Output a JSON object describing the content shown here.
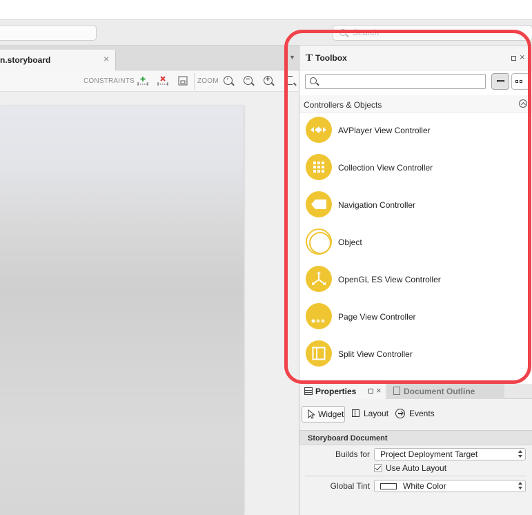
{
  "toolbar": {
    "search_placeholder": "Search"
  },
  "document": {
    "tab_label": "n.storyboard",
    "close_glyph": "×",
    "overflow_glyph": "▼"
  },
  "designer": {
    "constraints_label": "CONSTRAINTS",
    "zoom_label": "ZOOM"
  },
  "toolbox": {
    "title": "Toolbox",
    "search_placeholder": "",
    "section": "Controllers & Objects",
    "items": [
      {
        "label": "AVPlayer View Controller",
        "icon": "media-player-icon"
      },
      {
        "label": "Collection View Controller",
        "icon": "grid-icon"
      },
      {
        "label": "Navigation Controller",
        "icon": "back-tag-icon"
      },
      {
        "label": "Object",
        "icon": "object-ring-icon"
      },
      {
        "label": "OpenGL ES View Controller",
        "icon": "axes-3d-icon"
      },
      {
        "label": "Page View Controller",
        "icon": "page-dots-icon"
      },
      {
        "label": "Split View Controller",
        "icon": "split-view-icon"
      }
    ]
  },
  "properties": {
    "tab_title": "Properties",
    "outline_tab_title": "Document Outline",
    "subtabs": {
      "widget": "Widget",
      "layout": "Layout",
      "events": "Events"
    },
    "group_title": "Storyboard Document",
    "builds_for_label": "Builds for",
    "builds_for_value": "Project Deployment Target",
    "auto_layout_label": "Use Auto Layout",
    "auto_layout_checked": true,
    "global_tint_label": "Global Tint",
    "global_tint_value": "White Color"
  },
  "colors": {
    "accent_yellow": "#efc532",
    "highlight_red": "#f0424a"
  }
}
